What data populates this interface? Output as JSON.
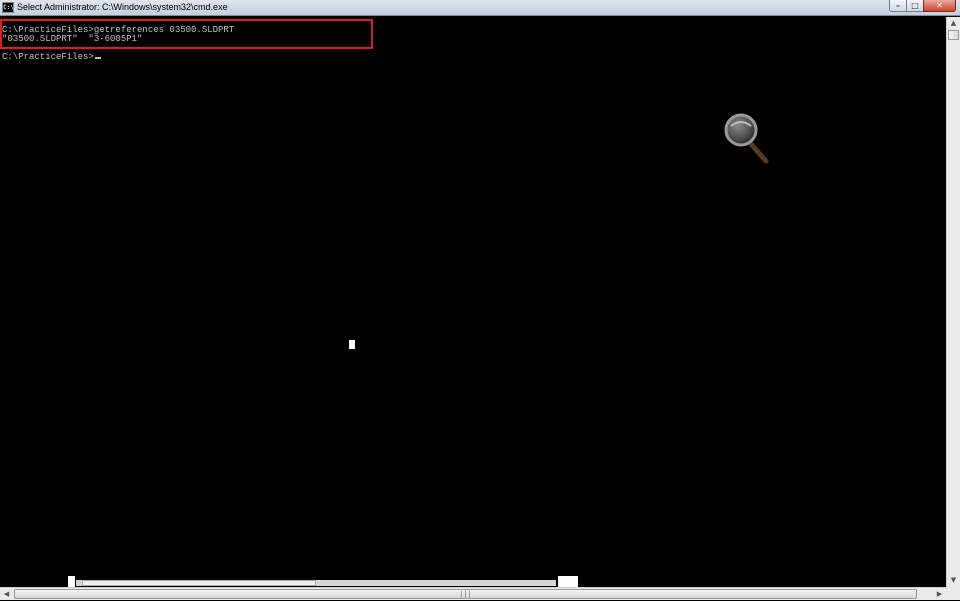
{
  "window": {
    "title": "Select Administrator: C:\\Windows\\system32\\cmd.exe",
    "icon_text": "C:\\",
    "controls": {
      "minimize": "–",
      "maximize": "□",
      "close": "✕"
    }
  },
  "console": {
    "lines": [
      "C:\\PracticeFiles>getreferences 03500.SLDPRT",
      "\"03500.SLDPRT\"  \"3-6005P1\"",
      "C:\\PracticeFiles>"
    ],
    "text_color": "#c0c0c0",
    "background": "#000000",
    "highlight_color": "#e31b1b"
  },
  "scrollbars": {
    "up_arrow": "▲",
    "down_arrow": "▼",
    "left_arrow": "◀",
    "right_arrow": "▶",
    "grip": "|||"
  },
  "icons": [
    "console-app-icon",
    "magnifier-icon"
  ]
}
